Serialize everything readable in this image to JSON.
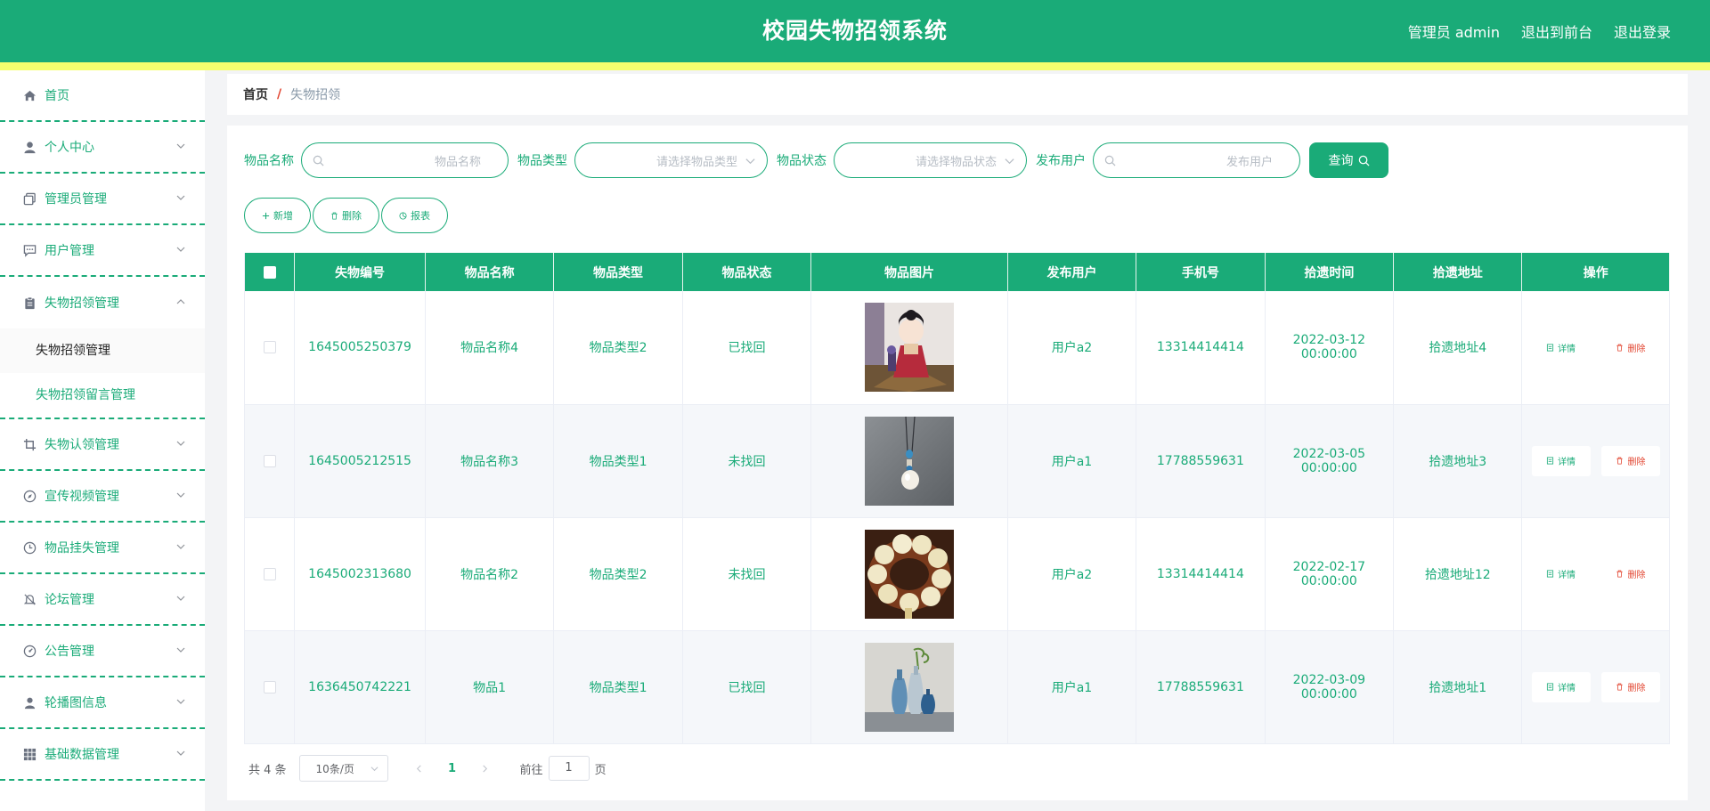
{
  "header": {
    "title": "校园失物招领系统",
    "user_label": "管理员 admin",
    "to_front": "退出到前台",
    "logout": "退出登录"
  },
  "sidebar": {
    "items": [
      {
        "label": "首页",
        "icon": "home-icon"
      },
      {
        "label": "个人中心",
        "icon": "user-icon"
      },
      {
        "label": "管理员管理",
        "icon": "copy-icon"
      },
      {
        "label": "用户管理",
        "icon": "chat-icon"
      },
      {
        "label": "失物招领管理",
        "icon": "clipboard-icon",
        "open": true,
        "children": [
          {
            "label": "失物招领管理",
            "active": true
          },
          {
            "label": "失物招领留言管理"
          }
        ]
      },
      {
        "label": "失物认领管理",
        "icon": "crop-icon"
      },
      {
        "label": "宣传视频管理",
        "icon": "compass-icon"
      },
      {
        "label": "物品挂失管理",
        "icon": "clock-icon"
      },
      {
        "label": "论坛管理",
        "icon": "bell-off-icon"
      },
      {
        "label": "公告管理",
        "icon": "gauge-icon"
      },
      {
        "label": "轮播图信息",
        "icon": "person-icon"
      },
      {
        "label": "基础数据管理",
        "icon": "grid-icon"
      }
    ]
  },
  "breadcrumb": {
    "home": "首页",
    "sep": "/",
    "current": "失物招领"
  },
  "search": {
    "name_label": "物品名称",
    "name_placeholder": "物品名称",
    "type_label": "物品类型",
    "type_placeholder": "请选择物品类型",
    "status_label": "物品状态",
    "status_placeholder": "请选择物品状态",
    "user_label": "发布用户",
    "user_placeholder": "发布用户",
    "query_button": "查询"
  },
  "actions": {
    "add": "新增",
    "delete": "删除",
    "report": "报表"
  },
  "table": {
    "columns": [
      "失物编号",
      "物品名称",
      "物品类型",
      "物品状态",
      "物品图片",
      "发布用户",
      "手机号",
      "拾遗时间",
      "拾遗地址",
      "操作"
    ],
    "detail_label": "详情",
    "delete_label": "删除",
    "rows": [
      {
        "id": "1645005250379",
        "name": "物品名称4",
        "type": "物品类型2",
        "status": "已找回",
        "image": "doll-figurine",
        "user": "用户a2",
        "phone": "13314414414",
        "time": "2022-03-12 00:00:00",
        "address": "拾遗地址4"
      },
      {
        "id": "1645005212515",
        "name": "物品名称3",
        "type": "物品类型1",
        "status": "未找回",
        "image": "jade-pendant",
        "user": "用户a1",
        "phone": "17788559631",
        "time": "2022-03-05 00:00:00",
        "address": "拾遗地址3"
      },
      {
        "id": "1645002313680",
        "name": "物品名称2",
        "type": "物品类型2",
        "status": "未找回",
        "image": "bead-bracelet",
        "user": "用户a2",
        "phone": "13314414414",
        "time": "2022-02-17 00:00:00",
        "address": "拾遗地址12"
      },
      {
        "id": "1636450742221",
        "name": "物品1",
        "type": "物品类型1",
        "status": "已找回",
        "image": "ceramic-vases",
        "user": "用户a1",
        "phone": "17788559631",
        "time": "2022-03-09 00:00:00",
        "address": "拾遗地址1"
      }
    ]
  },
  "pagination": {
    "total": "共 4 条",
    "page_size": "10条/页",
    "current": "1",
    "goto_prefix": "前往",
    "goto_value": "1",
    "goto_suffix": "页"
  },
  "colors": {
    "primary": "#1aab78",
    "accent_strip": "#f5ff6e",
    "danger": "#e2442f"
  }
}
